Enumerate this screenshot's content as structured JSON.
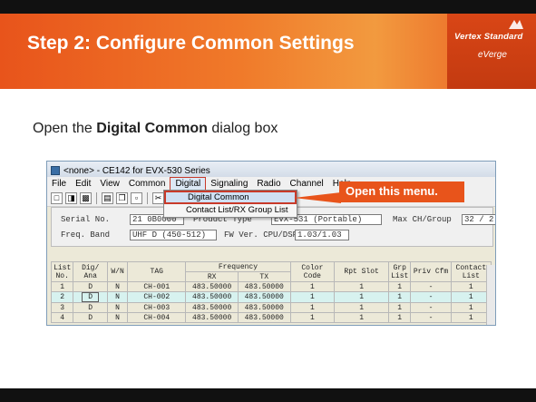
{
  "slide": {
    "title": "Step 2: Configure Common Settings",
    "instruction_prefix": "Open the ",
    "instruction_bold": "Digital Common",
    "instruction_suffix": " dialog box",
    "brand_name": "Vertex Standard",
    "brand_tagline": "eVerge",
    "callout": "Open this menu.",
    "colors": {
      "orange": "#e8541b",
      "highlight_red": "#c83a2a"
    }
  },
  "window": {
    "title": "<none> - CE142 for EVX-530 Series",
    "menus": [
      "File",
      "Edit",
      "View",
      "Common",
      "Digital",
      "Signaling",
      "Radio",
      "Channel",
      "Help"
    ],
    "active_menu": "Digital",
    "dropdown": [
      "Digital Common",
      "Contact List/RX Group List"
    ],
    "toolbar_icons": [
      "new-file-icon",
      "open-folder-icon",
      "save-icon",
      "print-icon",
      "copy-icon",
      "paste-icon",
      "cut-icon",
      "read-icon"
    ]
  },
  "info": {
    "serial_label": "Serial No.",
    "serial_value": "21 0B0000",
    "product_label": "Product Type",
    "product_value": "EVX-531 (Portable)",
    "maxch_label": "Max CH/Group",
    "maxch_value": "32 / 2",
    "band_label": "Freq. Band",
    "band_value": "UHF D (450-512)",
    "fw_label": "FW Ver. CPU/DSP",
    "fw_value": "1.03/1.03"
  },
  "grid": {
    "headers": {
      "list": "List No.",
      "dig": "Dig/ Ana",
      "wn": "W/N",
      "tag": "TAG",
      "freq": "Frequency",
      "rx": "RX",
      "tx": "TX",
      "color": "Color Code",
      "slot": "Rpt Slot",
      "grp": "Grp List",
      "priv": "Priv Cfm",
      "contact": "Contact List"
    },
    "rows": [
      {
        "no": "1",
        "dig": "D",
        "wn": "N",
        "tag": "CH-001",
        "rx": "483.50000",
        "tx": "483.50000",
        "cc": "1",
        "slot": "1",
        "grp": "1",
        "priv": "-",
        "contact": "1"
      },
      {
        "no": "2",
        "dig": "D",
        "wn": "N",
        "tag": "CH-002",
        "rx": "483.50000",
        "tx": "483.50000",
        "cc": "1",
        "slot": "1",
        "grp": "1",
        "priv": "-",
        "contact": "1"
      },
      {
        "no": "3",
        "dig": "D",
        "wn": "N",
        "tag": "CH-003",
        "rx": "483.50000",
        "tx": "483.50000",
        "cc": "1",
        "slot": "1",
        "grp": "1",
        "priv": "-",
        "contact": "1"
      },
      {
        "no": "4",
        "dig": "D",
        "wn": "N",
        "tag": "CH-004",
        "rx": "483.50000",
        "tx": "483.50000",
        "cc": "1",
        "slot": "1",
        "grp": "1",
        "priv": "-",
        "contact": "1"
      }
    ]
  }
}
